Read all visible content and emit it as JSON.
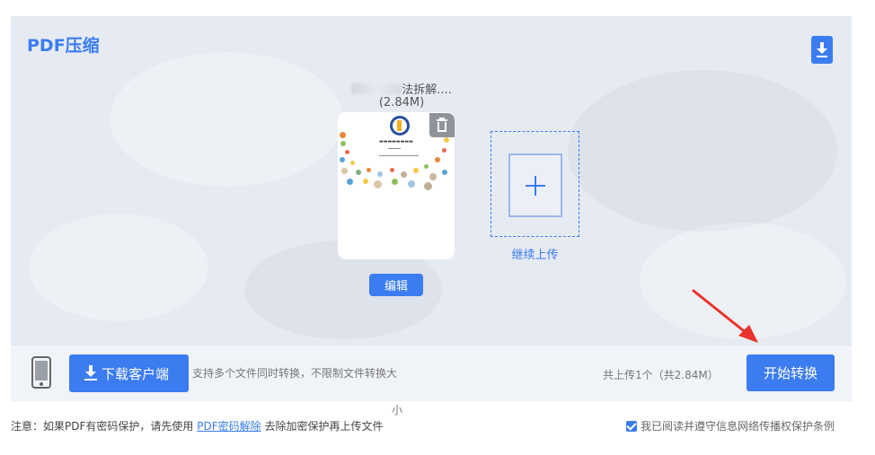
{
  "panel": {
    "title": "PDF压缩",
    "download_icon": "download-icon"
  },
  "file": {
    "name_suffix": "法拆解....",
    "size": "(2.84M)",
    "delete_icon": "trash-icon",
    "edit_label": "编辑"
  },
  "add": {
    "label": "继续上传",
    "icon": "plus-icon"
  },
  "footer": {
    "phone_icon": "phone-icon",
    "client_button_label": "下载客户端",
    "support_note": "支持多个文件同时转换，不限制文件转换大",
    "support_note_wrap": "小",
    "upload_count": "共上传1个（共2.84M）",
    "convert_button_label": "开始转换"
  },
  "notice": {
    "prefix": "注意：如果PDF有密码保护，请先使用",
    "link": "PDF密码解除",
    "suffix": "去除加密保护再上传文件"
  },
  "agreement": {
    "checked": true,
    "label": "我已阅读并遵守信息网络传播权保护条例"
  },
  "colors": {
    "accent": "#3b7cf0",
    "panel_bg": "#e6eaf2",
    "annotation_arrow": "#e8322a"
  }
}
